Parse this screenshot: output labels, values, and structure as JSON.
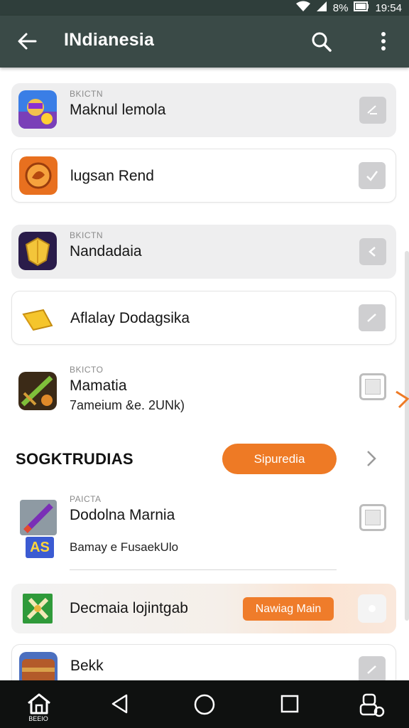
{
  "status_bar": {
    "battery": "8%",
    "time": "19:54"
  },
  "app_bar": {
    "title": "INdianesia"
  },
  "items": [
    {
      "tag": "BKICTN",
      "name": "Maknul lemola",
      "sub": ""
    },
    {
      "tag": "",
      "name": "lugsan Rend",
      "sub": ""
    },
    {
      "tag": "BKICTN",
      "name": "Nandadaia",
      "sub": ""
    },
    {
      "tag": "",
      "name": "Aflalay Dodagsika",
      "sub": ""
    },
    {
      "tag": "BKICTO",
      "name": "Mamatia",
      "sub": "7ameium &e. 2UNk)"
    }
  ],
  "section": {
    "title": "SOGKTRUDIAS",
    "button": "Sipuredia"
  },
  "featured": {
    "tag": "PAICTA",
    "name": "Dodolna Marnia",
    "sub": "Bamay e FusaekUlo",
    "icon_text": "AS"
  },
  "promo": {
    "name": "Decmaia lojintgab",
    "button": "Nawiag Main"
  },
  "last_item": {
    "name": "Bekk"
  },
  "nav": {
    "home_label": "BEEIO"
  },
  "colors": {
    "appbar": "#3a4a47",
    "accent": "#ee7a25",
    "navbar": "#0f1110"
  },
  "icons": [
    "back-arrow-icon",
    "search-icon",
    "more-vert-icon",
    "check-icon",
    "chevron-right-icon",
    "home-icon",
    "back-triangle-icon",
    "circle-home-icon",
    "square-recents-icon",
    "accessibility-icon"
  ]
}
